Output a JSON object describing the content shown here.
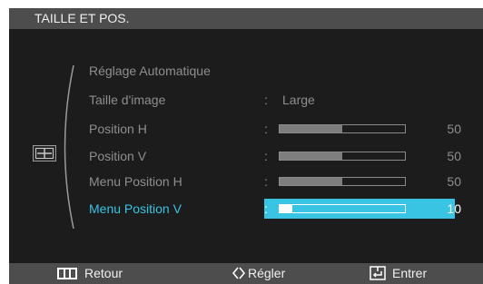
{
  "header": {
    "title": "TAILLE ET POS."
  },
  "menu": {
    "items": [
      {
        "label": "Réglage Automatique"
      },
      {
        "label": "Taille d'image",
        "colon": ":",
        "value": "Large"
      },
      {
        "label": "Position H",
        "colon": ":",
        "level": 50,
        "value": "50"
      },
      {
        "label": "Position V",
        "colon": ":",
        "level": 50,
        "value": "50"
      },
      {
        "label": "Menu Position H",
        "colon": ":",
        "level": 50,
        "value": "50"
      },
      {
        "label": "Menu Position V",
        "colon": ":",
        "level": 10,
        "value": "10",
        "selected": true
      }
    ]
  },
  "footer": {
    "back_label": "Retour",
    "adjust_label": "Régler",
    "enter_label": "Entrer"
  },
  "icons": {
    "category": "size-position-icon",
    "back": "menu-bars-icon",
    "adjust": "diamond-arrows-icon",
    "enter": "enter-icon"
  },
  "colors": {
    "highlight": "#39c4e3",
    "bar_bg": "#4d4d4d",
    "panel_bg": "#1c1c1c",
    "inactive_text": "#8e8e8e"
  }
}
